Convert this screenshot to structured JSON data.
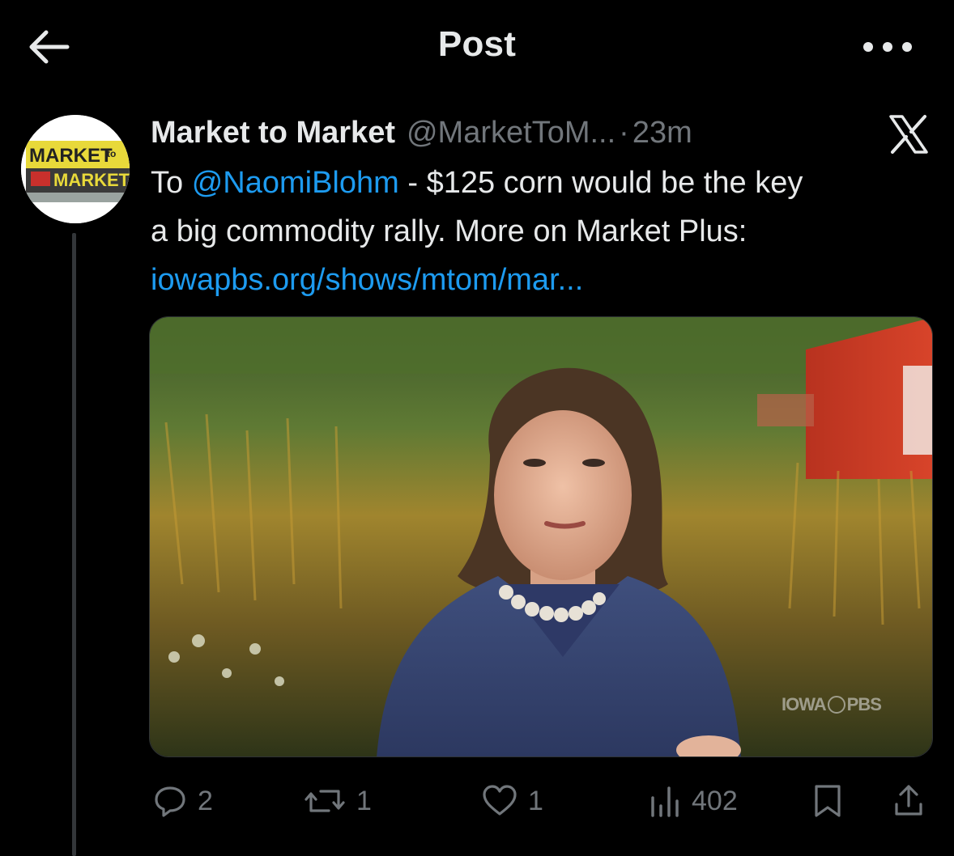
{
  "header": {
    "title": "Post",
    "back_icon": "arrow-left-icon",
    "more_icon": "more-horizontal-icon"
  },
  "post": {
    "author_name": "Market to Market",
    "handle": "@MarketToM...",
    "separator": "·",
    "time": "23m",
    "avatar_lines": [
      "MARKET",
      "to",
      "MARKET"
    ],
    "text": {
      "line1_prefix": "To ",
      "mention": "@NaomiBlohm",
      "line1_suffix": " - $125 corn would be the key",
      "line2": "a big commodity rally. More on Market Plus:",
      "link": "iowapbs.org/shows/mtom/mar..."
    },
    "media": {
      "watermark": "IOWA PBS",
      "watermark_left": "IOWA",
      "watermark_right": "PBS"
    }
  },
  "actions": {
    "replies": "2",
    "reposts": "1",
    "likes": "1",
    "views": "402"
  },
  "colors": {
    "background": "#000000",
    "text": "#e7e9ea",
    "secondary": "#71767b",
    "link": "#1d9bf0"
  }
}
